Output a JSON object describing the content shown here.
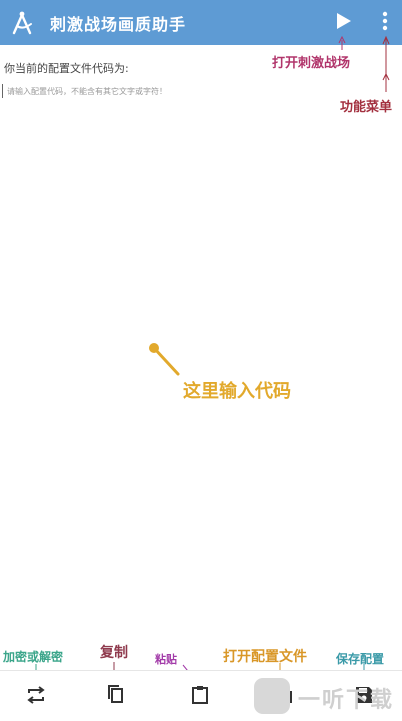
{
  "appbar": {
    "title": "刺激战场画质助手",
    "app_icon": "compass-icon",
    "play_icon": "play-icon",
    "more_icon": "more-vert-icon"
  },
  "main": {
    "prompt_label": "你当前的配置文件代码为:",
    "input_value": "",
    "input_placeholder": "请输入配置代码，不能含有其它文字或字符！"
  },
  "annotations": {
    "play": "打开刺激战场",
    "menu": "功能菜单",
    "input": "这里输入代码",
    "encrypt": "加密或解密",
    "copy": "复制",
    "paste": "粘贴",
    "open_file": "打开配置文件",
    "save": "保存配置"
  },
  "annotation_colors": {
    "play": "#b1356b",
    "menu": "#a3303f",
    "input": "#e2a92c",
    "encrypt": "#3aa58a",
    "copy": "#8f3a4d",
    "paste": "#a23aa8",
    "open_file": "#d99728",
    "save": "#3a9aa8"
  },
  "toolbar": {
    "encrypt_icon": "repeat-icon",
    "copy_icon": "copy-icon",
    "paste_icon": "clipboard-icon",
    "open_icon": "folder-icon",
    "save_icon": "floppy-icon"
  },
  "watermark": {
    "text": "一听下载"
  },
  "colors": {
    "appbar": "#5e9bd4"
  }
}
